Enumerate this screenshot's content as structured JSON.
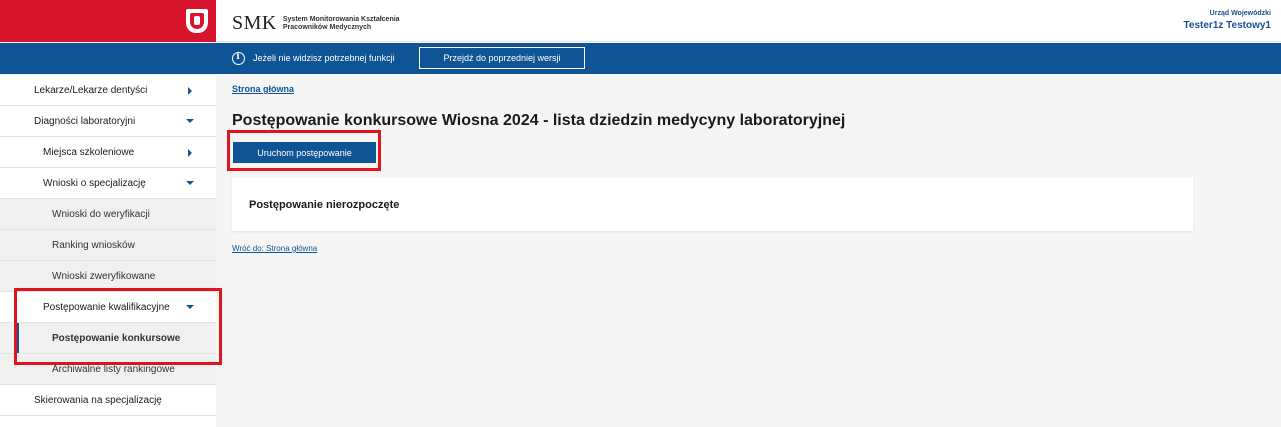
{
  "header": {
    "brand": "SMK",
    "brand_line1": "System Monitorowania Kształcenia",
    "brand_line2": "Pracowników Medycznych",
    "user_org": "Urząd Wojewódzki",
    "user_name": "Tester1z Testowy1"
  },
  "infobar": {
    "text": "Jeżeli nie widzisz potrzebnej funkcji",
    "button_label": "Przejdź do poprzedniej wersji"
  },
  "sidebar": {
    "items": [
      {
        "label": "Lekarze/Lekarze dentyści",
        "level": 1,
        "icon": "chevron-right-icon"
      },
      {
        "label": "Diagności laboratoryjni",
        "level": 1,
        "icon": "chevron-down-icon"
      },
      {
        "label": "Miejsca szkoleniowe",
        "level": 2,
        "icon": "chevron-right-icon"
      },
      {
        "label": "Wnioski o specjalizację",
        "level": 2,
        "icon": "chevron-down-icon"
      },
      {
        "label": "Wnioski do weryfikacji",
        "level": 3
      },
      {
        "label": "Ranking wniosków",
        "level": 3
      },
      {
        "label": "Wnioski zweryfikowane",
        "level": 3
      },
      {
        "label": "Postępowanie kwalifikacyjne",
        "level": 2,
        "icon": "chevron-down-icon"
      },
      {
        "label": "Postępowanie konkursowe",
        "level": 3,
        "active": true
      },
      {
        "label": "Archiwalne listy rankingowe",
        "level": 3
      },
      {
        "label": "Skierowania na specjalizację",
        "level": 1
      }
    ]
  },
  "main": {
    "breadcrumb": "Strona główna",
    "title": "Postępowanie konkursowe Wiosna 2024 - lista dziedzin medycyny laboratoryjnej",
    "run_button": "Uruchom postępowanie",
    "card_title": "Postępowanie nierozpoczęte",
    "back_link": "Wróć do: Strona główna"
  },
  "colors": {
    "accent": "#0f5596",
    "flag_red": "#d7142b",
    "highlight": "#e0141c"
  }
}
